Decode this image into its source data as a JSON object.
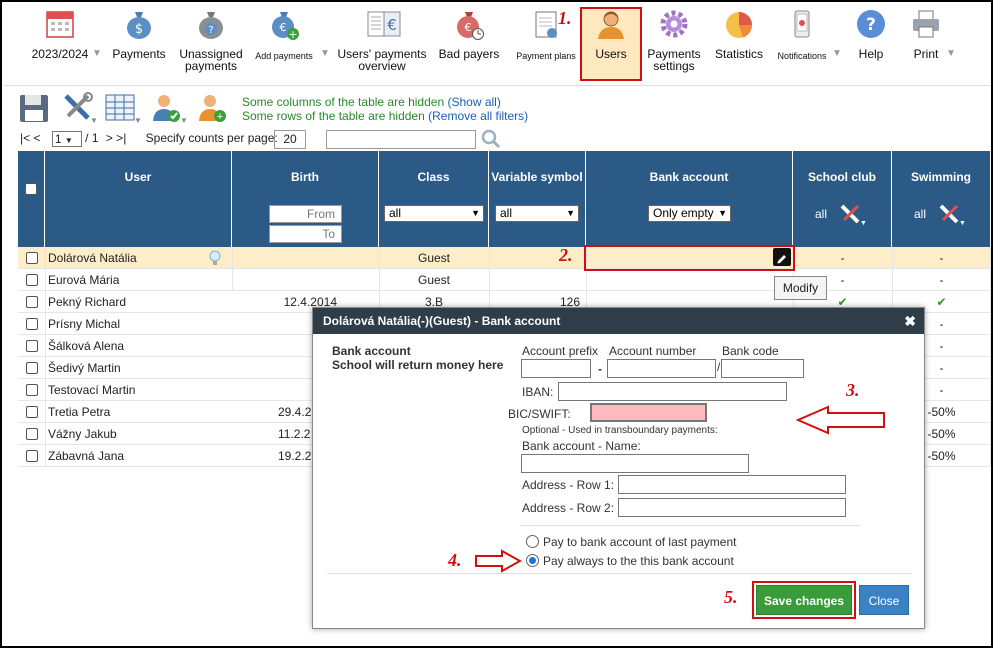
{
  "toolbar": {
    "items": [
      {
        "label": "2023/2024",
        "icon": "calendar-icon"
      },
      {
        "label": "Payments",
        "icon": "money-bag-icon"
      },
      {
        "label": "Unassigned payments",
        "icon": "question-bag-icon"
      },
      {
        "label": "Add payments",
        "icon": "add-money-icon"
      },
      {
        "label": "Users' payments overview",
        "icon": "ledger-icon"
      },
      {
        "label": "Bad payers",
        "icon": "bad-payer-icon"
      },
      {
        "label": "Payment plans",
        "icon": "payment-plan-icon"
      },
      {
        "label": "Users",
        "icon": "user-icon"
      },
      {
        "label": "Payments settings",
        "icon": "gear-icon"
      },
      {
        "label": "Statistics",
        "icon": "pie-chart-icon"
      },
      {
        "label": "Notifications",
        "icon": "phone-icon"
      },
      {
        "label": "Help",
        "icon": "help-icon"
      },
      {
        "label": "Print",
        "icon": "printer-icon"
      }
    ]
  },
  "steps": {
    "s1": "1.",
    "s2": "2.",
    "s3": "3.",
    "s4": "4.",
    "s5": "5."
  },
  "notices": {
    "cols_hidden": "Some columns of the table are hidden",
    "show_all": "(Show all)",
    "rows_hidden": "Some rows of the table are hidden",
    "remove_filters": "(Remove all filters)"
  },
  "pager": {
    "first_prev": "|< <",
    "page": "1",
    "of": "/ 1",
    "next_last": "> >|",
    "counts_label": "Specify counts per page:",
    "counts_value": "20"
  },
  "table": {
    "headers": {
      "user": "User",
      "birth": "Birth",
      "class": "Class",
      "variable_symbol": "Variable symbol",
      "bank_account": "Bank account",
      "school_club": "School club",
      "swimming": "Swimming"
    },
    "filters": {
      "from": "From",
      "to": "To",
      "class": "all",
      "vs": "all",
      "bank": "Only empty",
      "club": "all",
      "swim": "all"
    },
    "rows": [
      {
        "name": "Dolárová Natália",
        "birth": "",
        "class": "Guest",
        "vs": "",
        "club": "-",
        "swim": "-"
      },
      {
        "name": "Eurová Mária",
        "birth": "",
        "class": "Guest",
        "vs": "",
        "club": "-",
        "swim": "-"
      },
      {
        "name": "Pekný Richard",
        "birth": "12.4.2014",
        "class": "3.B",
        "vs": "126",
        "club": "✔",
        "swim": "✔"
      },
      {
        "name": "Prísny Michal",
        "birth": "",
        "class": "",
        "vs": "",
        "club": "",
        "swim": "-"
      },
      {
        "name": "Šálková Alena",
        "birth": "",
        "class": "",
        "vs": "",
        "club": "",
        "swim": "-"
      },
      {
        "name": "Šedivý Martin",
        "birth": "",
        "class": "",
        "vs": "",
        "club": "",
        "swim": "-"
      },
      {
        "name": "Testovací Martin",
        "birth": "",
        "class": "",
        "vs": "",
        "club": "",
        "swim": "-"
      },
      {
        "name": "Tretia Petra",
        "birth": "29.4.2",
        "class": "",
        "vs": "",
        "club": "",
        "swim": "-50%"
      },
      {
        "name": "Vážny Jakub",
        "birth": "11.2.2",
        "class": "",
        "vs": "",
        "club": "",
        "swim": "-50%"
      },
      {
        "name": "Zábavná Jana",
        "birth": "19.2.2",
        "class": "",
        "vs": "",
        "club": "",
        "swim": "-50%"
      }
    ]
  },
  "tooltip": "Modify",
  "dialog": {
    "title": "Dolárová Natália(-)(Guest) - Bank account",
    "section_title": "Bank account",
    "section_sub": "School will return money here",
    "prefix_label": "Account prefix",
    "number_label": "Account number",
    "code_label": "Bank code",
    "dash": "-",
    "slash": "/",
    "iban_label": "IBAN:",
    "bic_label": "BIC/SWIFT:",
    "optional_note": "Optional - Used in transboundary payments:",
    "name_label": "Bank account - Name:",
    "addr1_label": "Address - Row 1:",
    "addr2_label": "Address - Row 2:",
    "radio1": "Pay to bank account of last payment",
    "radio2": "Pay always to the this bank account",
    "save": "Save changes",
    "close": "Close"
  },
  "colors": {
    "header": "#2b5a86",
    "highlight_row": "#fdedc8",
    "annotation": "#d01010",
    "save": "#3a9b3a",
    "close": "#3b82c4"
  }
}
